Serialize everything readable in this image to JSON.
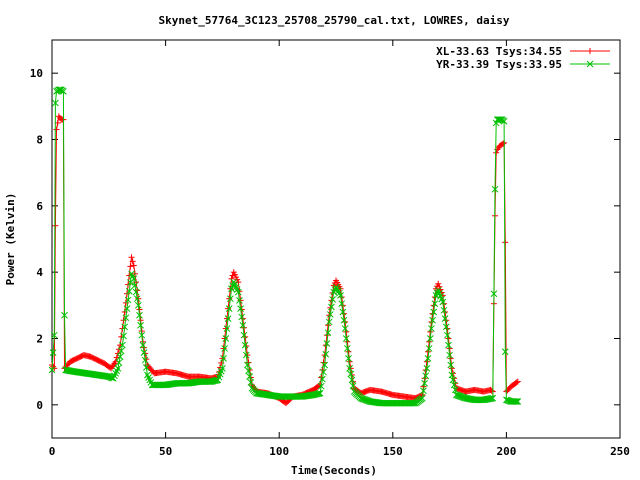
{
  "chart_data": {
    "type": "line",
    "title": "Skynet_57764_3C123_25708_25790_cal.txt, LOWRES, daisy",
    "xlabel": "Time(Seconds)",
    "ylabel": "Power (Kelvin)",
    "xlim": [
      0,
      250
    ],
    "ylim": [
      -1,
      11
    ],
    "xticks": [
      0,
      50,
      100,
      150,
      200,
      250
    ],
    "yticks": [
      0,
      2,
      4,
      6,
      8,
      10
    ],
    "grid": false,
    "legend_position": "top-right",
    "series": [
      {
        "name": "XL-33.63 Tsys:34.55",
        "color": "#ff0000",
        "marker": "plus",
        "points": [
          [
            0,
            1.2
          ],
          [
            1,
            1.1
          ],
          [
            1.5,
            5.4
          ],
          [
            2,
            8.3
          ],
          [
            3,
            8.7
          ],
          [
            4,
            8.6
          ],
          [
            5,
            8.6
          ],
          [
            5.5,
            1.1
          ],
          [
            8,
            1.3
          ],
          [
            11,
            1.4
          ],
          [
            14,
            1.5
          ],
          [
            17,
            1.45
          ],
          [
            20,
            1.35
          ],
          [
            23,
            1.25
          ],
          [
            26,
            1.1
          ],
          [
            28,
            1.3
          ],
          [
            30,
            1.8
          ],
          [
            32,
            2.8
          ],
          [
            34,
            3.9
          ],
          [
            35,
            4.45
          ],
          [
            36,
            4.2
          ],
          [
            38,
            3.2
          ],
          [
            40,
            1.9
          ],
          [
            42,
            1.2
          ],
          [
            45,
            0.95
          ],
          [
            50,
            1.0
          ],
          [
            55,
            0.95
          ],
          [
            60,
            0.85
          ],
          [
            65,
            0.85
          ],
          [
            70,
            0.8
          ],
          [
            73,
            0.85
          ],
          [
            75,
            1.4
          ],
          [
            77,
            2.6
          ],
          [
            79,
            3.8
          ],
          [
            80,
            4.0
          ],
          [
            82,
            3.7
          ],
          [
            84,
            2.6
          ],
          [
            86,
            1.5
          ],
          [
            88,
            0.6
          ],
          [
            90,
            0.4
          ],
          [
            95,
            0.35
          ],
          [
            100,
            0.2
          ],
          [
            103,
            0.05
          ],
          [
            106,
            0.25
          ],
          [
            110,
            0.3
          ],
          [
            115,
            0.45
          ],
          [
            118,
            0.6
          ],
          [
            120,
            1.5
          ],
          [
            122,
            2.7
          ],
          [
            124,
            3.6
          ],
          [
            125,
            3.75
          ],
          [
            127,
            3.5
          ],
          [
            129,
            2.5
          ],
          [
            131,
            1.3
          ],
          [
            133,
            0.5
          ],
          [
            136,
            0.35
          ],
          [
            140,
            0.45
          ],
          [
            145,
            0.4
          ],
          [
            150,
            0.3
          ],
          [
            155,
            0.25
          ],
          [
            160,
            0.2
          ],
          [
            163,
            0.3
          ],
          [
            165,
            1.3
          ],
          [
            167,
            2.5
          ],
          [
            169,
            3.5
          ],
          [
            170,
            3.65
          ],
          [
            172,
            3.3
          ],
          [
            174,
            2.3
          ],
          [
            176,
            1.1
          ],
          [
            178,
            0.5
          ],
          [
            182,
            0.4
          ],
          [
            186,
            0.45
          ],
          [
            190,
            0.4
          ],
          [
            193,
            0.45
          ],
          [
            194,
            0.4
          ],
          [
            195,
            5.7
          ],
          [
            195.5,
            7.6
          ],
          [
            196,
            7.7
          ],
          [
            197,
            7.8
          ],
          [
            198,
            7.85
          ],
          [
            199,
            7.9
          ],
          [
            199.5,
            4.9
          ],
          [
            200,
            0.4
          ],
          [
            202,
            0.55
          ],
          [
            204,
            0.65
          ],
          [
            205,
            0.7
          ]
        ]
      },
      {
        "name": "YR-33.39 Tsys:33.95",
        "color": "#00c000",
        "marker": "cross",
        "points": [
          [
            0,
            1.05
          ],
          [
            1,
            2.1
          ],
          [
            1.5,
            9.1
          ],
          [
            2,
            9.45
          ],
          [
            3,
            9.5
          ],
          [
            4,
            9.5
          ],
          [
            5,
            9.45
          ],
          [
            5.5,
            2.7
          ],
          [
            6,
            1.05
          ],
          [
            10,
            1.0
          ],
          [
            15,
            0.95
          ],
          [
            20,
            0.9
          ],
          [
            25,
            0.85
          ],
          [
            27,
            0.8
          ],
          [
            29,
            1.1
          ],
          [
            31,
            1.8
          ],
          [
            33,
            2.9
          ],
          [
            35,
            3.95
          ],
          [
            36,
            3.8
          ],
          [
            38,
            3.0
          ],
          [
            40,
            1.8
          ],
          [
            42,
            0.9
          ],
          [
            44,
            0.6
          ],
          [
            50,
            0.6
          ],
          [
            55,
            0.65
          ],
          [
            60,
            0.65
          ],
          [
            65,
            0.7
          ],
          [
            70,
            0.7
          ],
          [
            73,
            0.75
          ],
          [
            75,
            1.1
          ],
          [
            77,
            2.3
          ],
          [
            79,
            3.5
          ],
          [
            80,
            3.7
          ],
          [
            82,
            3.4
          ],
          [
            84,
            2.4
          ],
          [
            86,
            1.2
          ],
          [
            88,
            0.5
          ],
          [
            90,
            0.35
          ],
          [
            95,
            0.3
          ],
          [
            100,
            0.25
          ],
          [
            105,
            0.25
          ],
          [
            110,
            0.25
          ],
          [
            115,
            0.3
          ],
          [
            118,
            0.35
          ],
          [
            120,
            1.2
          ],
          [
            122,
            2.5
          ],
          [
            124,
            3.4
          ],
          [
            125,
            3.55
          ],
          [
            127,
            3.3
          ],
          [
            129,
            2.3
          ],
          [
            131,
            1.1
          ],
          [
            133,
            0.4
          ],
          [
            136,
            0.2
          ],
          [
            140,
            0.1
          ],
          [
            145,
            0.05
          ],
          [
            150,
            0.05
          ],
          [
            155,
            0.05
          ],
          [
            160,
            0.05
          ],
          [
            163,
            0.2
          ],
          [
            165,
            1.1
          ],
          [
            167,
            2.3
          ],
          [
            169,
            3.3
          ],
          [
            170,
            3.45
          ],
          [
            172,
            3.1
          ],
          [
            174,
            2.1
          ],
          [
            176,
            0.9
          ],
          [
            178,
            0.3
          ],
          [
            182,
            0.2
          ],
          [
            186,
            0.15
          ],
          [
            190,
            0.15
          ],
          [
            194,
            0.2
          ],
          [
            195,
            6.5
          ],
          [
            195.5,
            8.5
          ],
          [
            196,
            8.6
          ],
          [
            197,
            8.6
          ],
          [
            198,
            8.6
          ],
          [
            199,
            8.55
          ],
          [
            199.5,
            1.6
          ],
          [
            200,
            0.15
          ],
          [
            202,
            0.1
          ],
          [
            205,
            0.1
          ]
        ]
      }
    ]
  }
}
